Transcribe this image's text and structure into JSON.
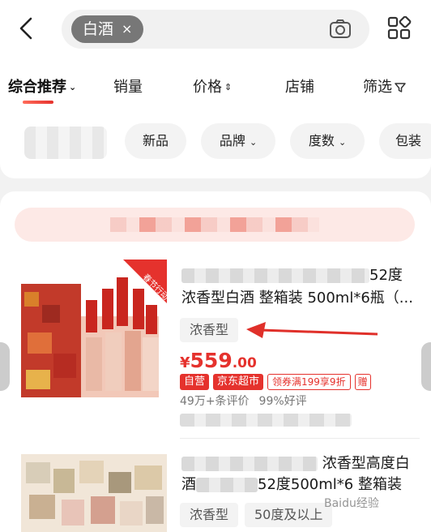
{
  "search": {
    "chip_text": "白酒",
    "chip_close": "×"
  },
  "sort_tabs": [
    {
      "label": "综合推荐",
      "caret": "⌄",
      "active": true
    },
    {
      "label": "销量"
    },
    {
      "label": "价格",
      "caret": "⇕"
    },
    {
      "label": "店铺"
    },
    {
      "label": "筛选",
      "icon": "filter-icon"
    }
  ],
  "filter_chips": [
    {
      "label": "新品"
    },
    {
      "label": "品牌",
      "caret": "⌄"
    },
    {
      "label": "度数",
      "caret": "⌄"
    },
    {
      "label": "包装"
    }
  ],
  "products": [
    {
      "title_line1_tail": "52度",
      "title_line2": "浓香型白酒 整箱装 500ml*6瓶（...",
      "tag": "浓香型",
      "price": {
        "currency": "¥",
        "integer": "559",
        "decimal": ".00"
      },
      "badges": {
        "self": "自营",
        "jd": "京东超市",
        "coupon": "领券满199享9折",
        "gift": "赠"
      },
      "reviews": {
        "count": "49万+条评价",
        "rate": "99%好评"
      },
      "image_banner": "春节行动"
    },
    {
      "title_line1_tail": "浓香型高度白",
      "title_line2_head": "酒",
      "title_line2_tail": "52度500ml*6 整箱装",
      "tags": [
        "浓香型",
        "50度及以上"
      ]
    }
  ],
  "watermark": "Baidu经验",
  "colors": {
    "accent": "#e5322d",
    "promo_bg": "#fde9e6"
  }
}
